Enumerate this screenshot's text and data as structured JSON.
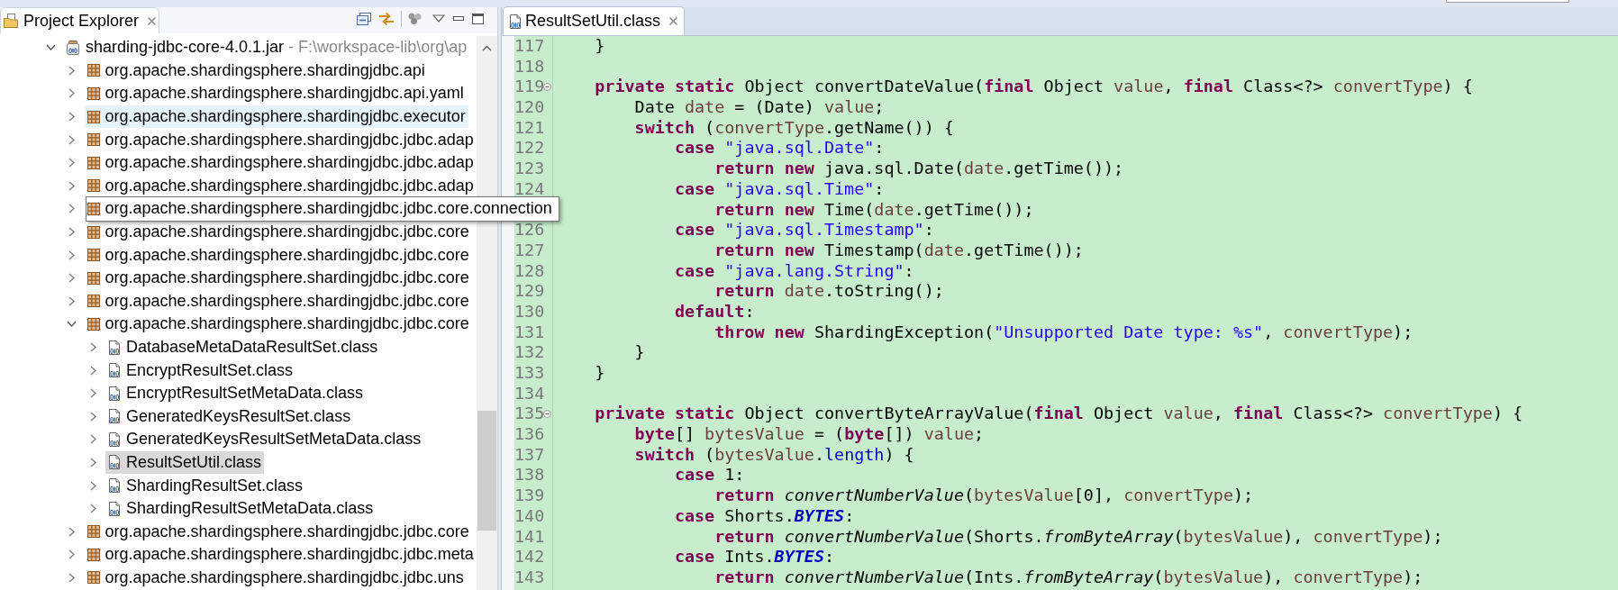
{
  "project_explorer": {
    "title": "Project Explorer",
    "tree": [
      {
        "kind": "jar",
        "label": "sharding-jdbc-core-4.0.1.jar",
        "decoration": "- F:\\workspace-lib\\org\\ap",
        "expanded": true,
        "selected": false,
        "hovered": false,
        "tooltip": false,
        "children": [
          {
            "kind": "package",
            "label": "org.apache.shardingsphere.shardingjdbc.api",
            "expanded": false,
            "selected": false,
            "hovered": false,
            "tooltip": false
          },
          {
            "kind": "package",
            "label": "org.apache.shardingsphere.shardingjdbc.api.yaml",
            "expanded": false,
            "selected": false,
            "hovered": false,
            "tooltip": false
          },
          {
            "kind": "package",
            "label": "org.apache.shardingsphere.shardingjdbc.executor",
            "expanded": false,
            "selected": false,
            "hovered": true,
            "tooltip": false
          },
          {
            "kind": "package",
            "label": "org.apache.shardingsphere.shardingjdbc.jdbc.adap",
            "expanded": false,
            "selected": false,
            "hovered": false,
            "tooltip": false
          },
          {
            "kind": "package",
            "label": "org.apache.shardingsphere.shardingjdbc.jdbc.adap",
            "expanded": false,
            "selected": false,
            "hovered": false,
            "tooltip": false
          },
          {
            "kind": "package",
            "label": "org.apache.shardingsphere.shardingjdbc.jdbc.adap",
            "expanded": false,
            "selected": false,
            "hovered": false,
            "tooltip": false
          },
          {
            "kind": "package",
            "label": "org.apache.shardingsphere.shardingjdbc.jdbc.core.connection",
            "expanded": false,
            "selected": false,
            "hovered": false,
            "tooltip": true
          },
          {
            "kind": "package",
            "label": "org.apache.shardingsphere.shardingjdbc.jdbc.core",
            "expanded": false,
            "selected": false,
            "hovered": false,
            "tooltip": false
          },
          {
            "kind": "package",
            "label": "org.apache.shardingsphere.shardingjdbc.jdbc.core",
            "expanded": false,
            "selected": false,
            "hovered": false,
            "tooltip": false
          },
          {
            "kind": "package",
            "label": "org.apache.shardingsphere.shardingjdbc.jdbc.core",
            "expanded": false,
            "selected": false,
            "hovered": false,
            "tooltip": false
          },
          {
            "kind": "package",
            "label": "org.apache.shardingsphere.shardingjdbc.jdbc.core",
            "expanded": false,
            "selected": false,
            "hovered": false,
            "tooltip": false
          },
          {
            "kind": "package",
            "label": "org.apache.shardingsphere.shardingjdbc.jdbc.core",
            "expanded": true,
            "selected": false,
            "hovered": false,
            "tooltip": false,
            "children": [
              {
                "kind": "class",
                "label": "DatabaseMetaDataResultSet.class",
                "expanded": false,
                "selected": false,
                "hovered": false,
                "tooltip": false
              },
              {
                "kind": "class",
                "label": "EncryptResultSet.class",
                "expanded": false,
                "selected": false,
                "hovered": false,
                "tooltip": false
              },
              {
                "kind": "class",
                "label": "EncryptResultSetMetaData.class",
                "expanded": false,
                "selected": false,
                "hovered": false,
                "tooltip": false
              },
              {
                "kind": "class",
                "label": "GeneratedKeysResultSet.class",
                "expanded": false,
                "selected": false,
                "hovered": false,
                "tooltip": false
              },
              {
                "kind": "class",
                "label": "GeneratedKeysResultSetMetaData.class",
                "expanded": false,
                "selected": false,
                "hovered": false,
                "tooltip": false
              },
              {
                "kind": "class",
                "label": "ResultSetUtil.class",
                "expanded": false,
                "selected": true,
                "hovered": false,
                "tooltip": false
              },
              {
                "kind": "class",
                "label": "ShardingResultSet.class",
                "expanded": false,
                "selected": false,
                "hovered": false,
                "tooltip": false
              },
              {
                "kind": "class",
                "label": "ShardingResultSetMetaData.class",
                "expanded": false,
                "selected": false,
                "hovered": false,
                "tooltip": false
              }
            ]
          },
          {
            "kind": "package",
            "label": "org.apache.shardingsphere.shardingjdbc.jdbc.core",
            "expanded": false,
            "selected": false,
            "hovered": false,
            "tooltip": false
          },
          {
            "kind": "package",
            "label": "org.apache.shardingsphere.shardingjdbc.jdbc.meta",
            "expanded": false,
            "selected": false,
            "hovered": false,
            "tooltip": false
          },
          {
            "kind": "package",
            "label": "org.apache.shardingsphere.shardingjdbc.jdbc.uns",
            "expanded": false,
            "selected": false,
            "hovered": false,
            "tooltip": false
          }
        ]
      }
    ]
  },
  "editor": {
    "tabs": [
      {
        "title": "ResultSetUtil.class",
        "selected": true
      }
    ],
    "lines": [
      {
        "number": "117",
        "segments": [
          {
            "text": "    }",
            "kind": "plain"
          }
        ]
      },
      {
        "number": "118"
      },
      {
        "number": "119",
        "expanded": true,
        "segments": [
          {
            "text": "    private",
            "kind": "keyword"
          },
          {
            "text": " static",
            "kind": "keyword"
          },
          {
            "text": " Object convertDateValue(",
            "kind": "plain"
          },
          {
            "text": "final",
            "kind": "keyword"
          },
          {
            "text": " Object ",
            "kind": "plain"
          },
          {
            "text": "value",
            "kind": "local"
          },
          {
            "text": ", ",
            "kind": "plain"
          },
          {
            "text": "final",
            "kind": "keyword"
          },
          {
            "text": " Class<?> ",
            "kind": "plain"
          },
          {
            "text": "convertType",
            "kind": "local"
          },
          {
            "text": ") {",
            "kind": "plain"
          }
        ]
      },
      {
        "number": "120",
        "segments": [
          {
            "text": "        Date ",
            "kind": "plain"
          },
          {
            "text": "date",
            "kind": "local"
          },
          {
            "text": " = (Date) ",
            "kind": "plain"
          },
          {
            "text": "value",
            "kind": "local"
          },
          {
            "text": ";",
            "kind": "plain"
          }
        ]
      },
      {
        "number": "121",
        "segments": [
          {
            "text": "        switch",
            "kind": "keyword"
          },
          {
            "text": " (",
            "kind": "plain"
          },
          {
            "text": "convertType",
            "kind": "local"
          },
          {
            "text": ".getName()) {",
            "kind": "plain"
          }
        ]
      },
      {
        "number": "122",
        "segments": [
          {
            "text": "            case",
            "kind": "keyword"
          },
          {
            "text": " \"java.sql.Date\"",
            "kind": "string"
          },
          {
            "text": ":",
            "kind": "plain"
          }
        ]
      },
      {
        "number": "123",
        "segments": [
          {
            "text": "                return",
            "kind": "keyword"
          },
          {
            "text": " new",
            "kind": "keyword"
          },
          {
            "text": " java.sql.Date(",
            "kind": "plain"
          },
          {
            "text": "date",
            "kind": "local"
          },
          {
            "text": ".getTime());",
            "kind": "plain"
          }
        ]
      },
      {
        "number": "124",
        "segments": [
          {
            "text": "            case",
            "kind": "keyword"
          },
          {
            "text": " \"java.sql.Time\"",
            "kind": "string"
          },
          {
            "text": ":",
            "kind": "plain"
          }
        ]
      },
      {
        "segments": [
          {
            "text": "                return",
            "kind": "keyword"
          },
          {
            "text": " new",
            "kind": "keyword"
          },
          {
            "text": " Time(",
            "kind": "plain"
          },
          {
            "text": "date",
            "kind": "local"
          },
          {
            "text": ".getTime());",
            "kind": "plain"
          }
        ]
      },
      {
        "number": "126",
        "segments": [
          {
            "text": "            case",
            "kind": "keyword"
          },
          {
            "text": " \"java.sql.Timestamp\"",
            "kind": "string"
          },
          {
            "text": ":",
            "kind": "plain"
          }
        ]
      },
      {
        "number": "127",
        "segments": [
          {
            "text": "                return",
            "kind": "keyword"
          },
          {
            "text": " new",
            "kind": "keyword"
          },
          {
            "text": " Timestamp(",
            "kind": "plain"
          },
          {
            "text": "date",
            "kind": "local"
          },
          {
            "text": ".getTime());",
            "kind": "plain"
          }
        ]
      },
      {
        "number": "128",
        "segments": [
          {
            "text": "            case",
            "kind": "keyword"
          },
          {
            "text": " \"java.lang.String\"",
            "kind": "string"
          },
          {
            "text": ":",
            "kind": "plain"
          }
        ]
      },
      {
        "number": "129",
        "segments": [
          {
            "text": "                return",
            "kind": "keyword"
          },
          {
            "text": " date",
            "kind": "local"
          },
          {
            "text": ".toString();",
            "kind": "plain"
          }
        ]
      },
      {
        "number": "130",
        "segments": [
          {
            "text": "            default",
            "kind": "keyword"
          },
          {
            "text": ":",
            "kind": "plain"
          }
        ]
      },
      {
        "number": "131",
        "segments": [
          {
            "text": "                throw",
            "kind": "keyword"
          },
          {
            "text": " new",
            "kind": "keyword"
          },
          {
            "text": " ShardingException(",
            "kind": "plain"
          },
          {
            "text": "\"Unsupported Date type: %s\"",
            "kind": "string"
          },
          {
            "text": ", ",
            "kind": "plain"
          },
          {
            "text": "convertType",
            "kind": "local"
          },
          {
            "text": ");",
            "kind": "plain"
          }
        ]
      },
      {
        "number": "132",
        "segments": [
          {
            "text": "        }",
            "kind": "plain"
          }
        ]
      },
      {
        "number": "133",
        "segments": [
          {
            "text": "    }",
            "kind": "plain"
          }
        ]
      },
      {
        "number": "134"
      },
      {
        "number": "135",
        "expanded": true,
        "segments": [
          {
            "text": "    private",
            "kind": "keyword"
          },
          {
            "text": " static",
            "kind": "keyword"
          },
          {
            "text": " Object convertByteArrayValue(",
            "kind": "plain"
          },
          {
            "text": "final",
            "kind": "keyword"
          },
          {
            "text": " Object ",
            "kind": "plain"
          },
          {
            "text": "value",
            "kind": "local"
          },
          {
            "text": ", ",
            "kind": "plain"
          },
          {
            "text": "final",
            "kind": "keyword"
          },
          {
            "text": " Class<?> ",
            "kind": "plain"
          },
          {
            "text": "convertType",
            "kind": "local"
          },
          {
            "text": ") {",
            "kind": "plain"
          }
        ]
      },
      {
        "number": "136",
        "segments": [
          {
            "text": "        byte",
            "kind": "keyword"
          },
          {
            "text": "[] ",
            "kind": "plain"
          },
          {
            "text": "bytesValue",
            "kind": "local"
          },
          {
            "text": " = (",
            "kind": "plain"
          },
          {
            "text": "byte",
            "kind": "keyword"
          },
          {
            "text": "[]) ",
            "kind": "plain"
          },
          {
            "text": "value",
            "kind": "local"
          },
          {
            "text": ";",
            "kind": "plain"
          }
        ]
      },
      {
        "number": "137",
        "segments": [
          {
            "text": "        switch",
            "kind": "keyword"
          },
          {
            "text": " (",
            "kind": "plain"
          },
          {
            "text": "bytesValue",
            "kind": "local"
          },
          {
            "text": ".",
            "kind": "plain"
          },
          {
            "text": "length",
            "kind": "field"
          },
          {
            "text": ") {",
            "kind": "plain"
          }
        ]
      },
      {
        "number": "138",
        "segments": [
          {
            "text": "            case",
            "kind": "keyword"
          },
          {
            "text": " 1:",
            "kind": "plain"
          }
        ]
      },
      {
        "number": "139",
        "segments": [
          {
            "text": "                return",
            "kind": "keyword"
          },
          {
            "text": " convertNumberValue",
            "kind": "static_call"
          },
          {
            "text": "(",
            "kind": "plain"
          },
          {
            "text": "bytesValue",
            "kind": "local"
          },
          {
            "text": "[0], ",
            "kind": "plain"
          },
          {
            "text": "convertType",
            "kind": "local"
          },
          {
            "text": ");",
            "kind": "plain"
          }
        ]
      },
      {
        "number": "140",
        "segments": [
          {
            "text": "            case",
            "kind": "keyword"
          },
          {
            "text": " Shorts.",
            "kind": "plain"
          },
          {
            "text": "BYTES",
            "kind": "constant"
          },
          {
            "text": ":",
            "kind": "plain"
          }
        ]
      },
      {
        "number": "141",
        "segments": [
          {
            "text": "                return",
            "kind": "keyword"
          },
          {
            "text": " convertNumberValue",
            "kind": "static_call"
          },
          {
            "text": "(Shorts.",
            "kind": "plain"
          },
          {
            "text": "fromByteArray",
            "kind": "static_call"
          },
          {
            "text": "(",
            "kind": "plain"
          },
          {
            "text": "bytesValue",
            "kind": "local"
          },
          {
            "text": "), ",
            "kind": "plain"
          },
          {
            "text": "convertType",
            "kind": "local"
          },
          {
            "text": ");",
            "kind": "plain"
          }
        ]
      },
      {
        "number": "142",
        "segments": [
          {
            "text": "            case",
            "kind": "keyword"
          },
          {
            "text": " Ints.",
            "kind": "plain"
          },
          {
            "text": "BYTES",
            "kind": "constant"
          },
          {
            "text": ":",
            "kind": "plain"
          }
        ]
      },
      {
        "number": "143",
        "segments": [
          {
            "text": "                return",
            "kind": "keyword"
          },
          {
            "text": " convertNumberValue",
            "kind": "static_call"
          },
          {
            "text": "(Ints.",
            "kind": "plain"
          },
          {
            "text": "fromByteArray",
            "kind": "static_call"
          },
          {
            "text": "(",
            "kind": "plain"
          },
          {
            "text": "bytesValue",
            "kind": "local"
          },
          {
            "text": "), ",
            "kind": "plain"
          },
          {
            "text": "convertType",
            "kind": "local"
          },
          {
            "text": ");",
            "kind": "plain"
          }
        ]
      }
    ]
  }
}
